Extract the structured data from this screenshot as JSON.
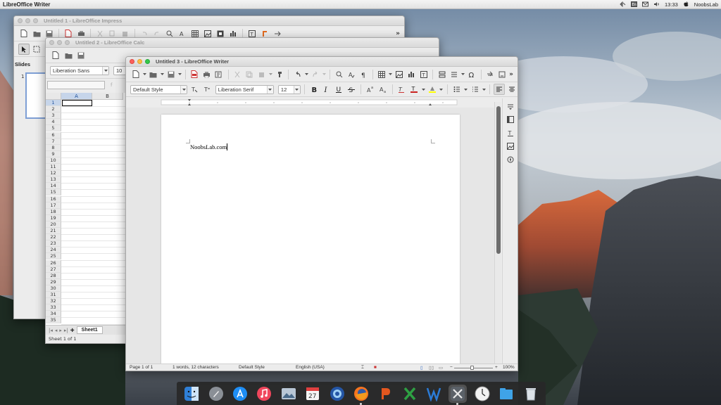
{
  "top_panel": {
    "app_title": "LibreOffice Writer",
    "clock": "13:33",
    "user": "NoobsLab",
    "icons": [
      "network-icon",
      "keyboard-icon",
      "mail-icon",
      "volume-icon",
      "power-icon"
    ]
  },
  "impress": {
    "title": "Untitled 1 - LibreOffice Impress",
    "panel_label": "Slides",
    "slide_number": "1"
  },
  "calc": {
    "title": "Untitled 2 - LibreOffice Calc",
    "font_name": "Liberation Sans",
    "font_size": "10",
    "columns": [
      "A",
      "B"
    ],
    "rows": [
      "1",
      "2",
      "3",
      "4",
      "5",
      "6",
      "7",
      "8",
      "9",
      "10",
      "11",
      "12",
      "13",
      "14",
      "15",
      "16",
      "17",
      "18",
      "19",
      "20",
      "21",
      "22",
      "23",
      "24",
      "25",
      "26",
      "27",
      "28",
      "29",
      "30",
      "31",
      "32",
      "33",
      "34",
      "35"
    ],
    "sheet_tab": "Sheet1",
    "status": "Sheet 1 of 1"
  },
  "writer": {
    "title": "Untitled 3 - LibreOffice Writer",
    "paragraph_style": "Default Style",
    "font_name": "Liberation Serif",
    "font_size": "12",
    "document_text": "NoobsLab.com",
    "status": {
      "page": "Page 1 of 1",
      "words": "1 words, 12 characters",
      "style": "Default Style",
      "language": "English (USA)",
      "zoom": "100%"
    },
    "zoom_percent": 100
  },
  "dock": {
    "items": [
      "finder-icon",
      "launchpad-icon",
      "app-store-icon",
      "itunes-icon",
      "photos-icon",
      "calendar-icon",
      "browser-icon",
      "firefox-icon",
      "wps-presentation-icon",
      "wps-spreadsheets-icon",
      "wps-writer-icon",
      "system-settings-icon",
      "clock-icon",
      "files-icon",
      "trash-icon"
    ],
    "calendar_day": "27"
  },
  "colors": {
    "close": "#fc605b",
    "minimize": "#fdbc40",
    "maximize": "#34c84a",
    "selection": "#c6d5ea",
    "dock_bg": "#282828"
  }
}
